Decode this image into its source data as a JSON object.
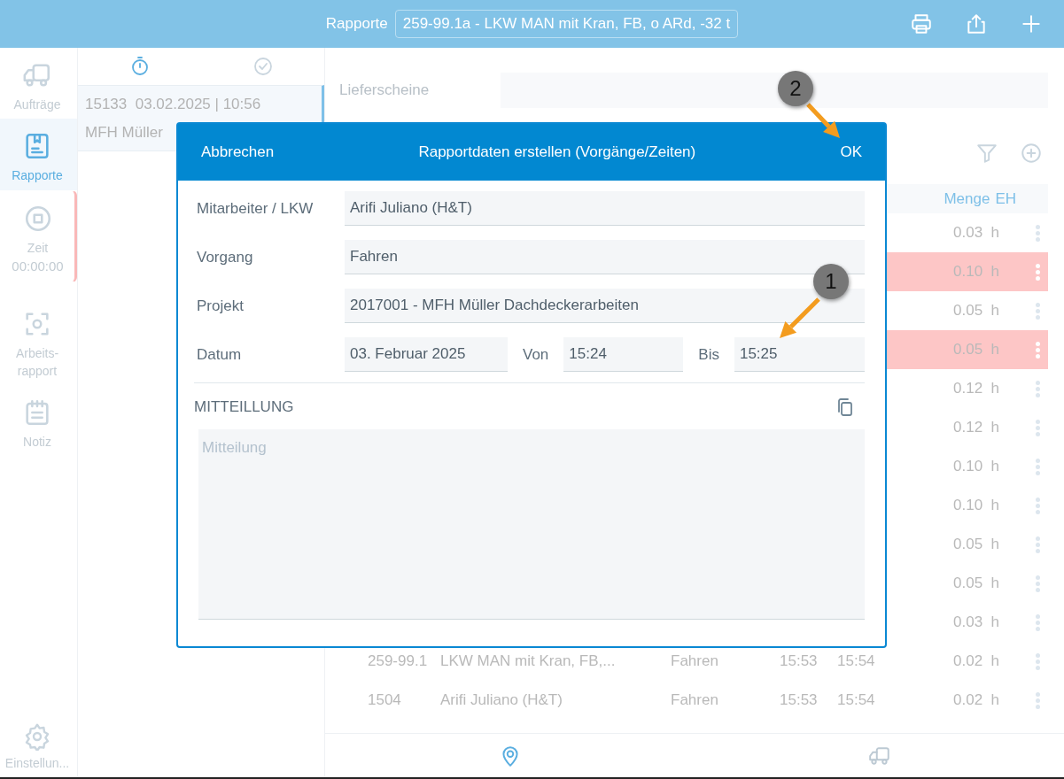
{
  "top_bar": {
    "title": "Rapporte",
    "vehicle": "259-99.1a - LKW MAN mit Kran, FB, o ARd, -32 t",
    "actions": [
      {
        "kind": "print"
      },
      {
        "kind": "share"
      },
      {
        "kind": "add"
      }
    ]
  },
  "sidebar": {
    "items": [
      {
        "kind": "orders",
        "label": "Aufträge",
        "selected": false,
        "alert": false
      },
      {
        "kind": "reports",
        "label": "Rapporte",
        "selected": true,
        "alert": false
      },
      {
        "kind": "time",
        "label": "Zeit",
        "sublabel": "00:00:00",
        "selected": false,
        "alert": true
      },
      {
        "kind": "work_report",
        "label": "Arbeits-rapport",
        "selected": false,
        "alert": false
      },
      {
        "kind": "note",
        "label": "Notiz",
        "selected": false,
        "alert": false
      }
    ],
    "settings": {
      "label": "Einstellun..."
    }
  },
  "list_pane": {
    "tabs": [
      {
        "kind": "timer",
        "selected": true
      },
      {
        "kind": "done",
        "selected": false
      }
    ],
    "items": [
      {
        "number": "15133",
        "date": "03.02.2025 | 10:56",
        "title": "MFH Müller",
        "selected": true
      }
    ]
  },
  "details": {
    "fields": [
      {
        "label": "Lieferscheine"
      }
    ]
  },
  "table": {
    "columns": [
      "Menge",
      "EH"
    ],
    "rows": [
      {
        "qty": "0.03",
        "unit": "h",
        "highlighted": false
      },
      {
        "qty": "0.10",
        "unit": "h",
        "highlighted": true
      },
      {
        "qty": "0.05",
        "unit": "h",
        "highlighted": false
      },
      {
        "qty": "0.05",
        "unit": "h",
        "highlighted": true
      },
      {
        "qty": "0.12",
        "unit": "h",
        "highlighted": false
      },
      {
        "qty": "0.12",
        "unit": "h",
        "highlighted": false
      },
      {
        "qty": "0.10",
        "unit": "h",
        "highlighted": false
      },
      {
        "qty": "0.10",
        "unit": "h",
        "highlighted": false
      },
      {
        "qty": "0.05",
        "unit": "h",
        "highlighted": false
      },
      {
        "qty": "0.05",
        "unit": "h",
        "highlighted": false
      },
      {
        "qty": "0.03",
        "unit": "h",
        "highlighted": false
      },
      {
        "id": "259-99.1",
        "name": "LKW MAN mit Kran, FB,...",
        "process": "Fahren",
        "from": "15:53",
        "to": "15:54",
        "qty": "0.02",
        "unit": "h",
        "highlighted": false
      },
      {
        "id": "1504",
        "name": "Arifi Juliano (H&T)",
        "process": "Fahren",
        "from": "15:53",
        "to": "15:54",
        "qty": "0.02",
        "unit": "h",
        "highlighted": false
      }
    ]
  },
  "bottom_tabs": [
    {
      "kind": "location",
      "selected": true
    },
    {
      "kind": "vehicle",
      "selected": false
    }
  ],
  "dialog": {
    "cancel": "Abbrechen",
    "title": "Rapportdaten erstellen (Vorgänge/Zeiten)",
    "ok": "OK",
    "fields": [
      {
        "label": "Mitarbeiter / LKW",
        "value": "Arifi Juliano (H&T)"
      },
      {
        "label": "Vorgang",
        "value": "Fahren"
      },
      {
        "label": "Projekt",
        "value": "2017001 - MFH Müller Dachdeckerarbeiten"
      }
    ],
    "date_row": {
      "label": "Datum",
      "date": "03. Februar 2025",
      "from_label": "Von",
      "from": "15:24",
      "to_label": "Bis",
      "to": "15:25"
    },
    "message": {
      "heading": "MITTEILLUNG",
      "placeholder": "Mitteilung"
    }
  },
  "callouts": [
    {
      "number": "1"
    },
    {
      "number": "2"
    }
  ]
}
